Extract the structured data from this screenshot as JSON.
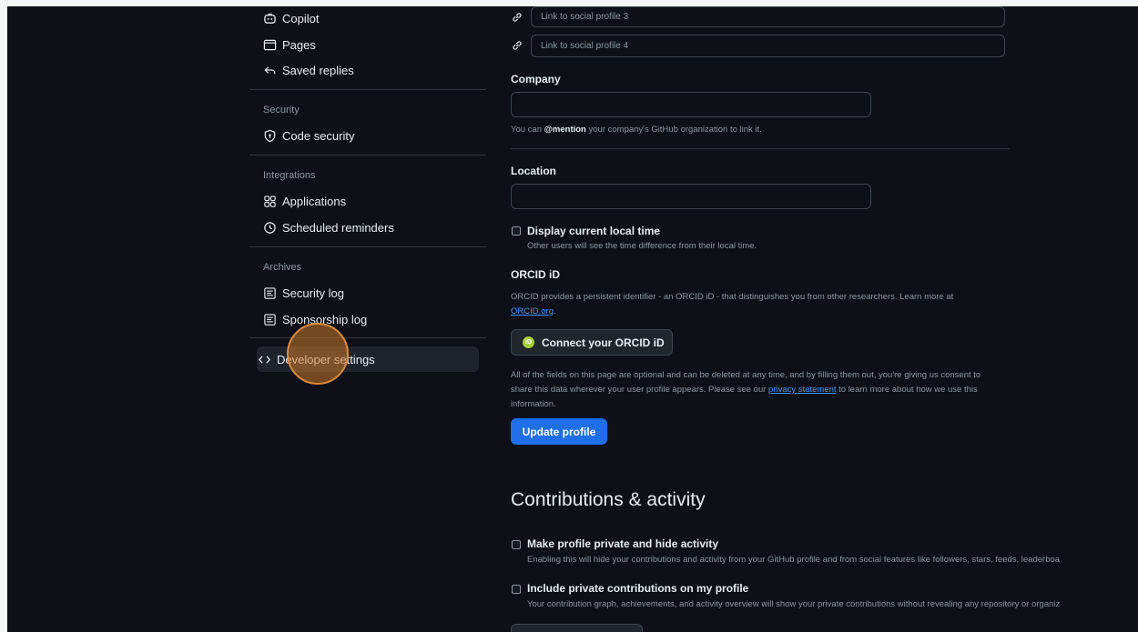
{
  "sidebar": {
    "top_items": [
      {
        "label": "Copilot",
        "icon": "copilot-icon"
      },
      {
        "label": "Pages",
        "icon": "browser-icon"
      },
      {
        "label": "Saved replies",
        "icon": "reply-icon"
      }
    ],
    "security": {
      "heading": "Security",
      "items": [
        {
          "label": "Code security",
          "icon": "shield-icon"
        }
      ]
    },
    "integrations": {
      "heading": "Integrations",
      "items": [
        {
          "label": "Applications",
          "icon": "apps-icon"
        },
        {
          "label": "Scheduled reminders",
          "icon": "clock-icon"
        }
      ]
    },
    "archives": {
      "heading": "Archives",
      "items": [
        {
          "label": "Security log",
          "icon": "log-icon"
        },
        {
          "label": "Sponsorship log",
          "icon": "log-icon"
        }
      ]
    },
    "developer_settings": {
      "label": "Developer settings",
      "icon": "code-icon"
    }
  },
  "form": {
    "social_links": [
      {
        "placeholder": "Link to social profile 3"
      },
      {
        "placeholder": "Link to social profile 4"
      }
    ],
    "company": {
      "label": "Company",
      "value": "",
      "note_prefix": "You can ",
      "note_mention": "@mention",
      "note_suffix": " your company's GitHub organization to link it."
    },
    "location": {
      "label": "Location",
      "value": ""
    },
    "local_time": {
      "label": "Display current local time",
      "description": "Other users will see the time difference from their local time.",
      "checked": false
    },
    "orcid": {
      "heading": "ORCID iD",
      "description": "ORCID provides a persistent identifier - an ORCID iD - that distinguishes you from other researchers. Learn more at",
      "link": "ORCID.org",
      "link_suffix": ".",
      "button": "Connect your ORCID iD",
      "button_icon": "orcid-icon"
    },
    "consent": {
      "text_before": "All of the fields on this page are optional and can be deleted at any time, and by filling them out, you're giving us consent to share this data wherever your user profile appears. Please see our ",
      "link": "privacy statement",
      "text_after": " to learn more about how we use this information."
    },
    "update_button": "Update profile"
  },
  "contributions": {
    "heading": "Contributions & activity",
    "private_profile": {
      "label": "Make profile private and hide activity",
      "description": "Enabling this will hide your contributions and activity from your GitHub profile and from social features like followers, stars, feeds, leaderboa",
      "checked": false
    },
    "private_contributions": {
      "label": "Include private contributions on my profile",
      "description": "Your contribution graph, achievements, and activity overview will show your private contributions without revealing any repository or organiz",
      "checked": false
    }
  },
  "colors": {
    "background": "#0d1117",
    "primary_button": "#1f6feb",
    "link": "#4493f8",
    "cursor_highlight": "#d98a3d"
  }
}
